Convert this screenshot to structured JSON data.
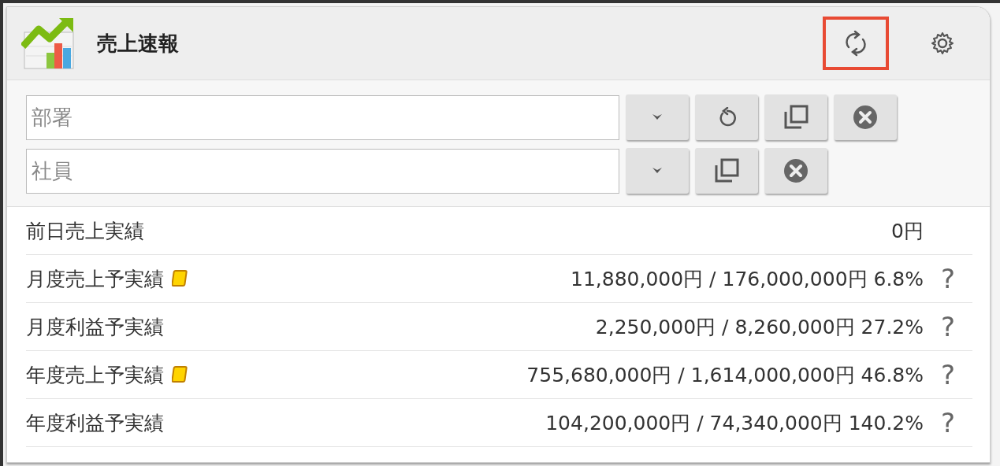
{
  "header": {
    "title": "売上速報",
    "actions": [
      {
        "kind": "refresh",
        "highlighted": true
      },
      {
        "kind": "settings",
        "highlighted": false
      }
    ]
  },
  "filters": [
    {
      "placeholder": "部署",
      "buttons": [
        {
          "kind": "dropdown"
        },
        {
          "kind": "reset"
        },
        {
          "kind": "copy"
        },
        {
          "kind": "clear"
        }
      ]
    },
    {
      "placeholder": "社員",
      "buttons": [
        {
          "kind": "dropdown"
        },
        {
          "kind": "copy"
        },
        {
          "kind": "clear"
        }
      ]
    }
  ],
  "rows": [
    {
      "label": "前日売上実績",
      "note": false,
      "value": "0円"
    },
    {
      "label": "月度売上予実績",
      "note": true,
      "value": "11,880,000円 / 176,000,000円 6.8%",
      "help": "?"
    },
    {
      "label": "月度利益予実績",
      "note": false,
      "value": "2,250,000円 / 8,260,000円 27.2%",
      "help": "?"
    },
    {
      "label": "年度売上予実績",
      "note": true,
      "value": "755,680,000円 / 1,614,000,000円 46.8%",
      "help": "?"
    },
    {
      "label": "年度利益予実績",
      "note": false,
      "value": "104,200,000円 / 74,340,000円 140.2%",
      "help": "?"
    }
  ]
}
